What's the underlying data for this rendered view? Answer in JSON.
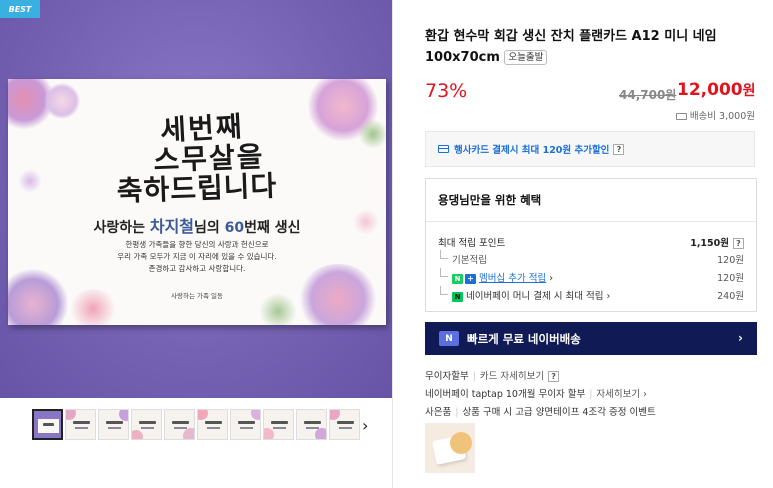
{
  "badge": "BEST",
  "card": {
    "headline_1": "세번째",
    "headline_2": "스무살을",
    "headline_3": "축하드립니다",
    "sub_pre": "사랑하는 ",
    "sub_name": "차지철",
    "sub_mid": "님의 ",
    "sub_num": "60",
    "sub_post": "번째 생신",
    "body_1": "한평생 가족들을 향한 당신의 사랑과 헌신으로",
    "body_2": "우리 가족 모두가 지금 이 자리에 있을 수 있습니다.",
    "body_3": "존경하고 감사하고 사랑합니다.",
    "sign": "사랑하는 가족 일동"
  },
  "thumbnails": {
    "count": 10,
    "next_icon": "chevron-right-icon"
  },
  "product": {
    "title": "환갑 현수막 회갑 생신 잔치 플랜카드 A12 미니 네임 100x70cm",
    "tag": "오늘출발",
    "discount": "73%",
    "original_price": "44,700원",
    "price": "12,000",
    "price_unit": "원",
    "shipping": "배송비 3,000원"
  },
  "card_offer": {
    "text": "행사카드 결제시 최대 120원 추가할인",
    "help": "?"
  },
  "benefit": {
    "title": "용댕님만을 위한 혜택",
    "rows": [
      {
        "label": "최대 적립 포인트",
        "value": "1,150원",
        "help": "?"
      },
      {
        "label": "기본적립",
        "value": "120원"
      },
      {
        "label": "멤버십 추가 적립",
        "value": "120원"
      },
      {
        "label": "네이버페이 머니 결제 시 최대 적립",
        "value": "240원"
      }
    ]
  },
  "banner": {
    "logo": "N",
    "text": "빠르게 무료 네이버배송",
    "arrow": "›"
  },
  "installment": {
    "line1_a": "무이자할부",
    "line1_b": "카드 자세히보기",
    "line1_help": "?",
    "line2_a": "네이버페이 taptap 10개월 무이자 할부",
    "line2_b": "자세히보기 ›",
    "line3_a": "사은품",
    "line3_b": "상품 구매 시 고급 양면테이프 4조각 증정 이벤트"
  },
  "colors": {
    "accent_red": "#e0141e",
    "naver_navy": "#101b56",
    "link_blue": "#1b6fd8",
    "hero_purple": "#7a66b8"
  }
}
